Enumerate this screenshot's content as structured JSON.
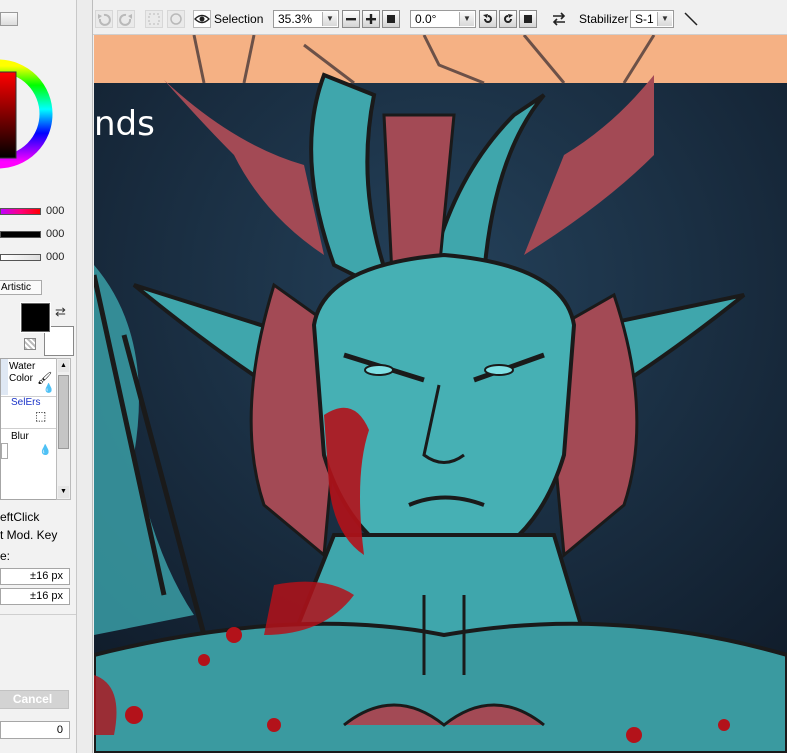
{
  "toolbar": {
    "selection_label": "Selection",
    "zoom_value": "35.3%",
    "rotation_value": "0.0°",
    "stabilizer_label": "Stabilizer",
    "stabilizer_value": "S-1"
  },
  "color_panel": {
    "slider_values": [
      "000",
      "000",
      "000"
    ],
    "mode_tab_label": "Artistic",
    "primary_color": "#000000",
    "secondary_color": "#ffffff"
  },
  "tools": {
    "items": [
      {
        "label": "Water Color"
      },
      {
        "label": "SelErs"
      },
      {
        "label": "Blur"
      }
    ]
  },
  "settings": {
    "left_click_label": "eftClick",
    "mod_key_label": "t Mod. Key",
    "size_label": "e:",
    "size_x": "±16 px",
    "size_y": "±16 px",
    "cancel_label": "Cancel",
    "bottom_value": "0"
  },
  "canvas": {
    "title_fragment": "nds",
    "colors": {
      "background": "#1a2a3c",
      "teal_layer": "#3fa6ac",
      "red_sketch": "#a34a55",
      "blood": "#b3121a",
      "peach_band": "#f5b184"
    }
  }
}
